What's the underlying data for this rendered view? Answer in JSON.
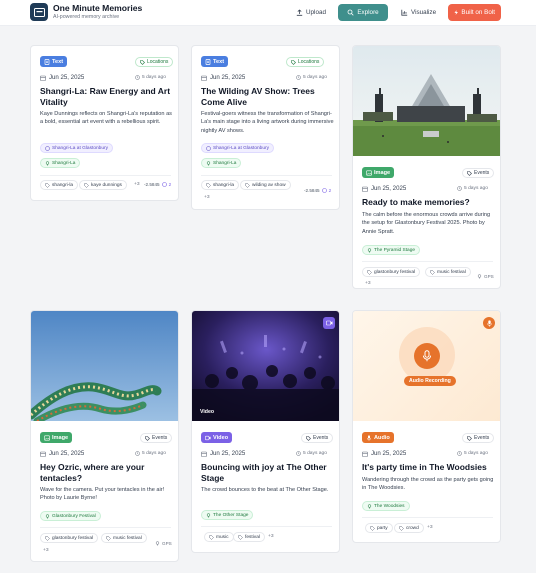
{
  "header": {
    "app_title": "One Minute Memories",
    "app_subtitle": "AI-powered memory archive",
    "nav": {
      "upload": "Upload",
      "explore": "Explore",
      "visualize": "Visualize",
      "bolt": "Built on Bolt"
    }
  },
  "colors": {
    "explore_bg": "#3f8f8c",
    "bolt_bg": "#f06248",
    "text_chip": "#4a7ee0",
    "image_chip": "#3fa86a",
    "video_chip": "#7b61e6",
    "audio_chip": "#e6732b"
  },
  "cards": [
    {
      "type": "Text",
      "category": "Locations",
      "date": "Jun 25, 2025",
      "ago": "5 days ago",
      "title": "Shangri-La: Raw Energy and Art Vitality",
      "description": "Kaye Dunnings reflects on Shangri-La's reputation as a bold, essential art event with a rebellious spirit.",
      "places": [
        "Shangri-La at Glastonbury",
        "Shangri-La"
      ],
      "tags": [
        "shangri-la",
        "kaye dunnings"
      ],
      "more": "+3",
      "coords": "-2.5845",
      "coords_extra": "2"
    },
    {
      "type": "Text",
      "category": "Locations",
      "date": "Jun 25, 2025",
      "ago": "5 days ago",
      "title": "The Wilding AV Show: Trees Come Alive",
      "description": "Festival-goers witness the transformation of Shangri-La's main stage into a living artwork during immersive nightly AV shows.",
      "places": [
        "Shangri-La at Glastonbury",
        "Shangri-La"
      ],
      "tags": [
        "shangri-la",
        "wilding av show"
      ],
      "more": "+3",
      "coords": "-2.5845",
      "coords_extra": "2"
    },
    {
      "type": "Image",
      "category": "Events",
      "date": "Jun 25, 2025",
      "ago": "5 days ago",
      "title": "Ready to make memories?",
      "description": "The calm before the enormous crowds arrive during the setup for Glastonbury Festival 2025. Photo by Annie Spratt.",
      "places": [
        "The Pyramid Stage"
      ],
      "tags": [
        "glastonbury festival",
        "music festival"
      ],
      "more": "+3",
      "gps": "GPS"
    },
    {
      "type": "Image",
      "category": "Events",
      "date": "Jun 25, 2025",
      "ago": "5 days ago",
      "title": "Hey Ozric, where are your tentacles?",
      "description": "Wave for the camera. Put your tentacles in the air! Photo by Laurie Byrne!",
      "places": [
        "Glastonbury Festival"
      ],
      "tags": [
        "glastonbury festival",
        "music festival"
      ],
      "more": "+3",
      "gps": "GPS"
    },
    {
      "type": "Video",
      "category": "Events",
      "date": "Jun 25, 2025",
      "ago": "5 days ago",
      "title": "Bouncing with joy at The Other Stage",
      "description": "The crowd bounces to the beat at The Other Stage.",
      "places": [
        "The Other Stage"
      ],
      "tags": [
        "music",
        "festival"
      ],
      "more": "+3",
      "media_label": "Video"
    },
    {
      "type": "Audio",
      "category": "Events",
      "date": "Jun 25, 2025",
      "ago": "5 days ago",
      "title": "It's party time in The Woodsies",
      "description": "Wandering through the crowd as the party gets going in The Woodsies.",
      "places": [
        "The Woodsies"
      ],
      "tags": [
        "party",
        "crowd"
      ],
      "more": "+3",
      "media_label": "Audio Recording"
    }
  ]
}
